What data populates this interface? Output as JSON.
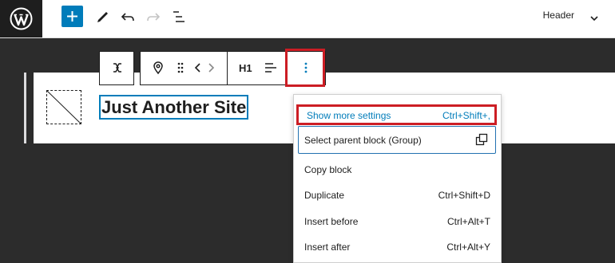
{
  "header": {
    "document_title": "Header",
    "icons": [
      "wordpress-logo",
      "plus-icon",
      "pencil-icon",
      "undo-icon",
      "redo-icon",
      "list-view-icon",
      "chevron-down-icon"
    ]
  },
  "canvas": {
    "site_title": "Just Another Site"
  },
  "block_toolbar": {
    "heading_level": "H1",
    "icons": [
      "group-transform-icon",
      "pin-icon",
      "drag-handle-icon",
      "move-left-icon",
      "move-right-icon",
      "align-icon",
      "more-options-icon"
    ]
  },
  "menu": {
    "items": [
      {
        "label": "Show more settings",
        "shortcut": "Ctrl+Shift+,"
      },
      {
        "label": "Select parent block (Group)",
        "shortcut": ""
      },
      {
        "label": "Copy block",
        "shortcut": ""
      },
      {
        "label": "Duplicate",
        "shortcut": "Ctrl+Shift+D"
      },
      {
        "label": "Insert before",
        "shortcut": "Ctrl+Alt+T"
      },
      {
        "label": "Insert after",
        "shortcut": "Ctrl+Alt+Y"
      }
    ]
  },
  "colors": {
    "accent": "#007cba",
    "highlight": "#cc1d24",
    "dark_bg": "#2c2c2c"
  }
}
